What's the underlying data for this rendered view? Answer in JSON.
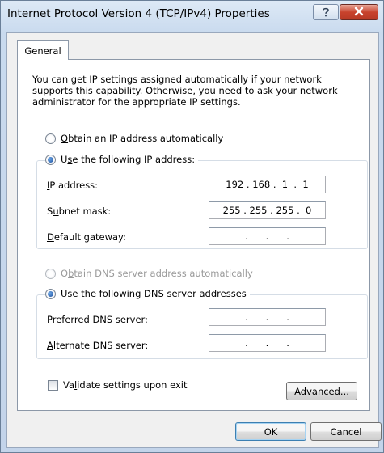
{
  "window": {
    "title": "Internet Protocol Version 4 (TCP/IPv4) Properties",
    "help_icon": "question-mark-icon",
    "close_icon": "close-x-icon"
  },
  "tabs": [
    {
      "label": "General",
      "selected": true
    }
  ],
  "description": [
    "You can get IP settings assigned automatically if your network",
    "supports this capability. Otherwise, you need to ask your network",
    "administrator for the appropriate IP settings."
  ],
  "ip_mode": {
    "auto_label": "Obtain an IP address automatically",
    "auto_label_parts": [
      "",
      "O",
      "btain an IP address automatically"
    ],
    "manual_label_parts": [
      "U",
      "s",
      "e the following IP address:"
    ],
    "selected": "manual"
  },
  "ip_fields": [
    {
      "label_parts": [
        "",
        "I",
        "P address:"
      ],
      "value": "192 . 168 .  1  .  1"
    },
    {
      "label_parts": [
        "S",
        "u",
        "bnet mask:"
      ],
      "value": "255 . 255 . 255 .  0"
    },
    {
      "label_parts": [
        "",
        "D",
        "efault gateway:"
      ],
      "value": " .      .      . "
    }
  ],
  "dns_mode": {
    "auto_label_parts": [
      "O",
      "b",
      "tain DNS server address automatically"
    ],
    "auto_enabled": false,
    "manual_label_parts": [
      "Us",
      "e",
      " the following DNS server addresses"
    ],
    "selected": "manual"
  },
  "dns_fields": [
    {
      "label_parts": [
        "",
        "P",
        "referred DNS server:"
      ],
      "value": " .      .      . "
    },
    {
      "label_parts": [
        "",
        "A",
        "lternate DNS server:"
      ],
      "value": " .      .      . "
    }
  ],
  "validate": {
    "label_parts": [
      "Va",
      "l",
      "idate settings upon exit"
    ],
    "checked": false
  },
  "buttons": {
    "advanced_parts": [
      "Ad",
      "v",
      "anced..."
    ],
    "ok": "OK",
    "cancel": "Cancel"
  },
  "colors": {
    "accent": "#3c7fb1",
    "close": "#c8432d"
  }
}
